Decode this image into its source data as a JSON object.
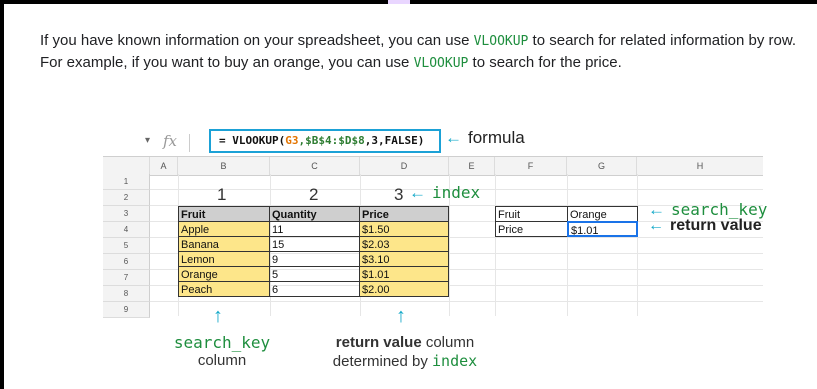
{
  "intro": {
    "line1_pre": "If you have known information on your spreadsheet, you can use ",
    "fn1": "VLOOKUP",
    "line1_post": " to search for related information by row. For example, if you want to buy an orange, you can use ",
    "fn2": "VLOOKUP",
    "line1_end": " to search for the price."
  },
  "formula_bar": {
    "fx_label": "fx",
    "formula_prefix": "= VLOOKUP(",
    "formula_ref": "G3",
    "formula_range": ",$B$4:$D$8",
    "formula_suffix": ",3,FALSE)",
    "formula_annotation": "formula",
    "arrow_left": "←"
  },
  "columns": [
    "A",
    "B",
    "C",
    "D",
    "E",
    "F",
    "G",
    "H"
  ],
  "rows": [
    "1",
    "2",
    "3",
    "4",
    "5",
    "6",
    "7",
    "8",
    "9"
  ],
  "column_numbers": [
    "1",
    "2",
    "3"
  ],
  "index_annotation": "index",
  "table": {
    "headers": [
      "Fruit",
      "Quantity",
      "Price"
    ],
    "rows": [
      [
        "Apple",
        "11",
        "$1.50"
      ],
      [
        "Banana",
        "15",
        "$2.03"
      ],
      [
        "Lemon",
        "9",
        "$3.10"
      ],
      [
        "Orange",
        "5",
        "$1.01"
      ],
      [
        "Peach",
        "6",
        "$2.00"
      ]
    ]
  },
  "lookup": {
    "fruit_label": "Fruit",
    "fruit_value": "Orange",
    "price_label": "Price",
    "price_value": "$1.01",
    "search_key_label": "search_key",
    "return_value_label": "return value"
  },
  "bottom": {
    "search_key_code": "search_key",
    "search_key_word": "column",
    "return_bold": "return value",
    "return_rest": " column",
    "determined_by": "determined by ",
    "index_code": "index",
    "arrow_up": "↑"
  },
  "colors": {
    "accent_arrow": "#11a8c8",
    "code_green": "#1e8e3e",
    "highlight_yellow": "#fde68a",
    "formula_border": "#1ba1d6"
  }
}
